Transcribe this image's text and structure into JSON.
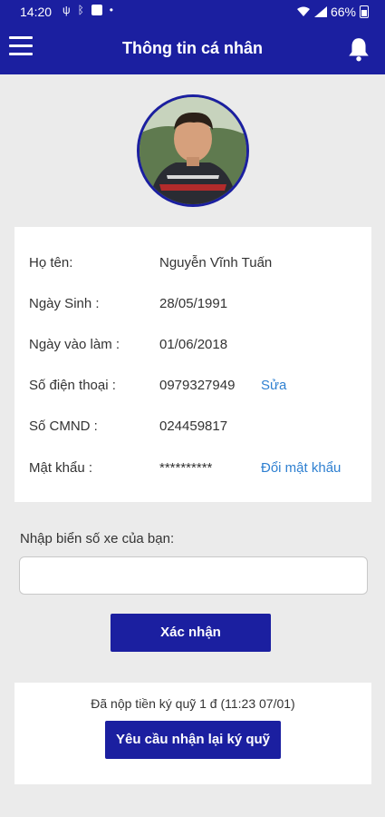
{
  "status_bar": {
    "time": "14:20",
    "battery": "66%"
  },
  "header": {
    "title": "Thông tin cá nhân",
    "menu_icon": "hamburger-menu-icon",
    "notification_icon": "bell-icon"
  },
  "profile": {
    "fields": [
      {
        "label": "Họ tên:",
        "value": "Nguyễn Vĩnh Tuấn"
      },
      {
        "label": "Ngày Sinh :",
        "value": "28/05/1991"
      },
      {
        "label": "Ngày vào làm :",
        "value": "01/06/2018"
      },
      {
        "label": "Số điện thoại :",
        "value": "0979327949",
        "action": "Sửa"
      },
      {
        "label": "Số CMND :",
        "value": "024459817"
      },
      {
        "label": "Mật khẩu :",
        "value": "**********",
        "action": "Đổi mật khẩu"
      }
    ]
  },
  "plate": {
    "label": "Nhập biển số xe của bạn:",
    "value": "",
    "confirm_label": "Xác nhận"
  },
  "deposit": {
    "text": "Đã nộp tiền ký quỹ 1 đ (11:23 07/01)",
    "button_label": "Yêu cầu nhận lại ký quỹ"
  },
  "colors": {
    "primary": "#1b1fa0",
    "link": "#2f80d1",
    "background": "#ebebeb"
  }
}
